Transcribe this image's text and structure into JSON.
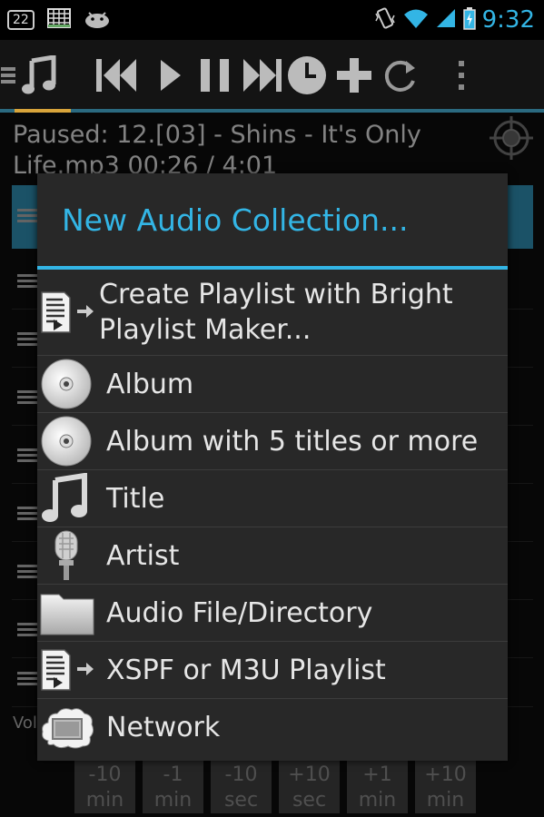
{
  "status_bar": {
    "notification_count": "22",
    "time": "9:32"
  },
  "toolbar": {
    "icons": [
      "menu-icon",
      "music-note-icon",
      "previous-icon",
      "play-icon",
      "pause-icon",
      "next-icon",
      "clock-icon",
      "add-icon",
      "repeat-icon",
      "overflow-icon"
    ]
  },
  "now_playing": {
    "line1": "Paused: 12.[03] - Shins - It's Only",
    "line2": "Life.mp3  00:26 / 4:01",
    "progress_fraction": 0.11
  },
  "background": {
    "volume_label": "Vol",
    "step_buttons": [
      {
        "top": "-10",
        "bottom": "min"
      },
      {
        "top": "-1",
        "bottom": "min"
      },
      {
        "top": "-10",
        "bottom": "sec"
      },
      {
        "top": "+10",
        "bottom": "sec"
      },
      {
        "top": "+1",
        "bottom": "min"
      },
      {
        "top": "+10",
        "bottom": "min"
      }
    ]
  },
  "dialog": {
    "title": "New Audio Collection...",
    "items": [
      {
        "label": "Create Playlist with Bright Playlist Maker...",
        "icon": "playlist-arrow-icon"
      },
      {
        "label": "Album",
        "icon": "disc-icon"
      },
      {
        "label": "Album with 5 titles or more",
        "icon": "disc-icon"
      },
      {
        "label": "Title",
        "icon": "music-note-icon"
      },
      {
        "label": "Artist",
        "icon": "microphone-icon"
      },
      {
        "label": "Audio File/Directory",
        "icon": "folder-icon"
      },
      {
        "label": "XSPF or M3U Playlist",
        "icon": "playlist-arrow-icon"
      },
      {
        "label": "Network",
        "icon": "network-cloud-icon"
      }
    ]
  },
  "colors": {
    "accent": "#33b5e5",
    "dialog_bg": "#282828",
    "progress": "#d8a43b"
  }
}
